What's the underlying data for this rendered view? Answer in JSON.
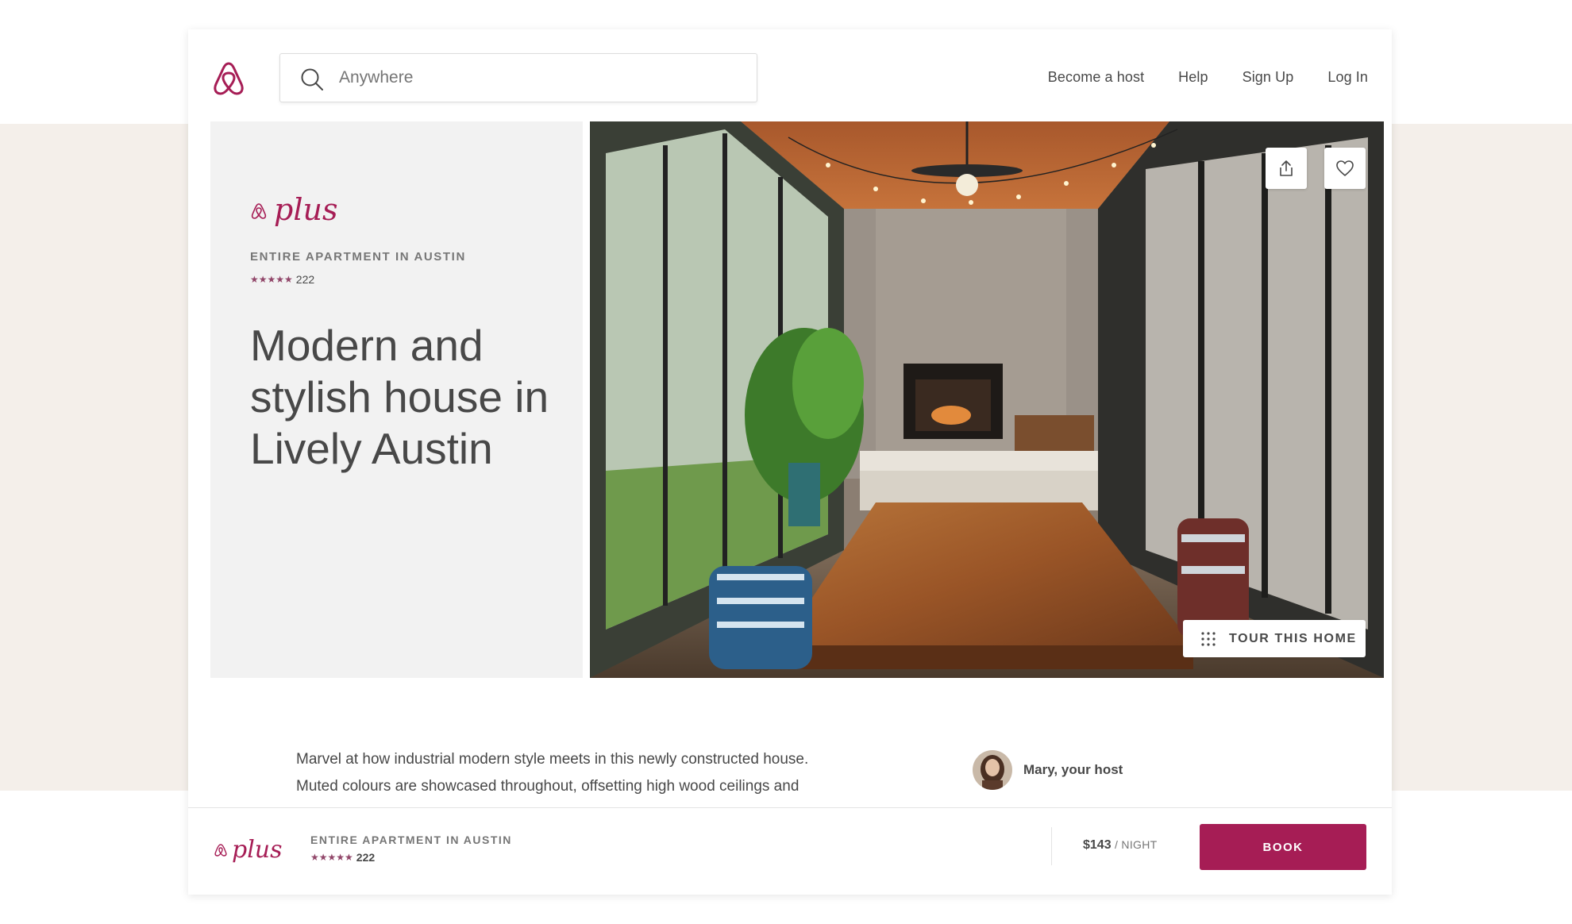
{
  "header": {
    "search_placeholder": "Anywhere",
    "nav": {
      "become_host": "Become a host",
      "help": "Help",
      "sign_up": "Sign Up",
      "log_in": "Log In"
    }
  },
  "listing": {
    "type": "ENTIRE APARTMENT IN AUSTIN",
    "stars": "★★★★★",
    "rating": 5,
    "reviews": "222",
    "title": "Modern and stylish house in Lively Austin",
    "plus_badge": "plus"
  },
  "photo_actions": {
    "tour_label": "TOUR THIS HOME"
  },
  "description": {
    "text": "Marvel at how industrial modern style meets in this newly constructed house. Muted colours are showcased throughout, offsetting high wood ceilings and"
  },
  "host": {
    "label": "Mary, your host"
  },
  "booking": {
    "type": "ENTIRE APARTMENT IN AUSTIN",
    "stars": "★★★★★",
    "reviews": "222",
    "price": "$143",
    "per": "/ NIGHT",
    "book_label": "BOOK"
  },
  "colors": {
    "brand": "#a61d55",
    "star": "#914669",
    "backdrop": "#f4efea"
  },
  "icons": [
    "airbnb-logo-icon",
    "search-icon",
    "share-icon",
    "heart-icon",
    "grid-dots-icon"
  ]
}
